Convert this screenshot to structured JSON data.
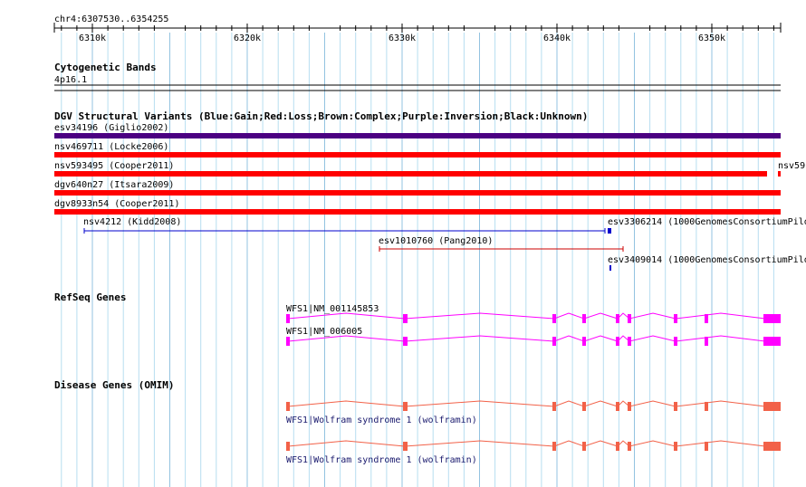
{
  "region": "chr4:6307530..6354255",
  "ruler": {
    "ticks": [
      "6310k",
      "6320k",
      "6330k",
      "6340k",
      "6350k"
    ]
  },
  "tracks": {
    "cytoband": {
      "title": "Cytogenetic Bands",
      "band": "4p16.1"
    },
    "dgv": {
      "title": "DGV Structural Variants (Blue:Gain;Red:Loss;Brown:Complex;Purple:Inversion;Black:Unknown)",
      "colors": {
        "gain": "#0000cc",
        "loss": "#ff0000",
        "complex": "#8b4513",
        "inversion": "#4b0082",
        "unknown": "#000000"
      },
      "features": [
        {
          "label": "esv34196 (Giglio2002)",
          "type": "inversion"
        },
        {
          "label": "nsv469711 (Locke2006)",
          "type": "loss"
        },
        {
          "label": "nsv593495 (Cooper2011)",
          "type": "loss"
        },
        {
          "label": "nsv59",
          "type": "loss"
        },
        {
          "label": "dgv640n27 (Itsara2009)",
          "type": "loss"
        },
        {
          "label": "dgv8933n54 (Cooper2011)",
          "type": "loss"
        },
        {
          "label": "nsv4212 (Kidd2008)",
          "type": "gain"
        },
        {
          "label": "esv3306214 (1000GenomesConsortiumPilo",
          "type": "gain"
        },
        {
          "label": "esv1010760 (Pang2010)",
          "type": "loss"
        },
        {
          "label": "esv3409014 (1000GenomesConsortiumPilo",
          "type": "gain"
        }
      ]
    },
    "refseq": {
      "title": "RefSeq Genes",
      "color": "#ff00ff",
      "transcripts": [
        {
          "label": "WFS1|NM_001145853"
        },
        {
          "label": "WFS1|NM_006005"
        }
      ]
    },
    "omim": {
      "title": "Disease Genes (OMIM)",
      "color": "#f26148",
      "entries": [
        {
          "label": "WFS1|Wolfram syndrome 1 (wolframin)"
        },
        {
          "label": "WFS1|Wolfram syndrome 1 (wolframin)"
        }
      ]
    }
  }
}
